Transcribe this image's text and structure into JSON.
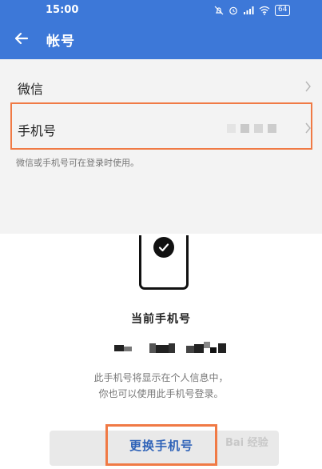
{
  "status_bar": {
    "time": "15:00",
    "battery": "64"
  },
  "header": {
    "title": "帐号"
  },
  "settings": {
    "items": [
      {
        "label": "微信"
      },
      {
        "label": "手机号"
      }
    ],
    "hint": "微信或手机号可在登录时使用。"
  },
  "sheet": {
    "current_title": "当前手机号",
    "desc_line1": "此手机号将显示在个人信息中，",
    "desc_line2": "你也可以使用此手机号登录。",
    "change_button": "更换手机号"
  },
  "watermark": "Bai 经验"
}
